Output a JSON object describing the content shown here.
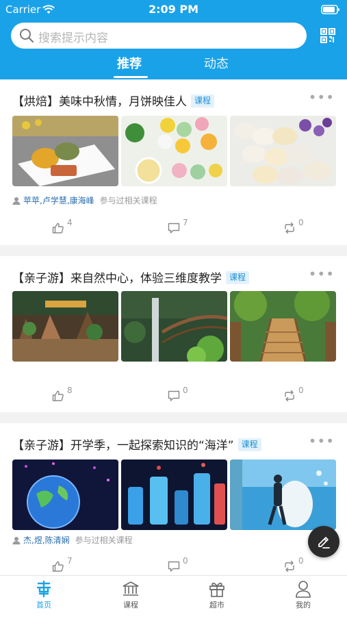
{
  "status_bar": {
    "carrier": "Carrier",
    "time": "2:09 PM"
  },
  "search": {
    "placeholder": "搜索提示内容"
  },
  "tabs": [
    {
      "label": "推荐",
      "active": true
    },
    {
      "label": "动态",
      "active": false
    }
  ],
  "colors": {
    "accent": "#1aa2e8",
    "tag_text": "#1a8fd6",
    "tag_bg": "#e3f1fb",
    "names": "#2a6fb0"
  },
  "feed": [
    {
      "title": "【烘焙】美味中秋情，月饼映佳人",
      "tag": "课程",
      "images": [
        "mooncakes-on-plate",
        "flower-mooncakes-with-tea",
        "snowskin-mooncakes"
      ],
      "participants": {
        "names": "苹苹,卢学慧,康海峰",
        "suffix": "参与过相关课程"
      },
      "likes": "4",
      "comments": "7",
      "shares": "0"
    },
    {
      "title": "【亲子游】来自然中心，体验三维度教学",
      "tag": "课程",
      "images": [
        "nature-center-entrance",
        "indoor-waterfall-walkway",
        "rope-bridge-canopy"
      ],
      "participants": null,
      "likes": "8",
      "comments": "0",
      "shares": "0"
    },
    {
      "title": "【亲子游】开学季，一起探索知识的“海洋”",
      "tag": "课程",
      "images": [
        "glowing-globe",
        "aquarium-tanks",
        "diver-with-beluga"
      ],
      "participants": {
        "names": "杰,煜,陈清娴",
        "suffix": "参与过相关课程"
      },
      "likes": "7",
      "comments": "0",
      "shares": "0"
    }
  ],
  "fab": {
    "icon": "edit-icon"
  },
  "bottom_nav": [
    {
      "label": "首页",
      "icon": "home-icon",
      "active": true
    },
    {
      "label": "课程",
      "icon": "course-icon",
      "active": false
    },
    {
      "label": "超市",
      "icon": "gift-icon",
      "active": false
    },
    {
      "label": "我的",
      "icon": "profile-icon",
      "active": false
    }
  ]
}
